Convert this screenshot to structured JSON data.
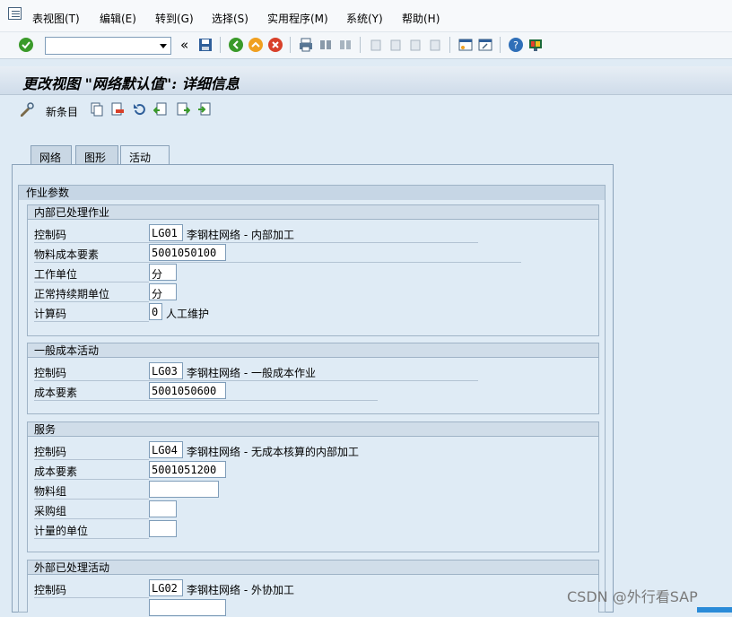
{
  "menu": [
    "表视图(T)",
    "编辑(E)",
    "转到(G)",
    "选择(S)",
    "实用程序(M)",
    "系统(Y)",
    "帮助(H)"
  ],
  "toolbar": {
    "command_value": "",
    "collapse_symbol": "«"
  },
  "title": "更改视图 \"网络默认值\": 详细信息",
  "app_toolbar": {
    "new_entries": "新条目"
  },
  "tabs": [
    "网络",
    "图形",
    "活动"
  ],
  "active_tab": "活动",
  "section_title": "作业参数",
  "groups": {
    "internal": {
      "title": "内部已处理作业",
      "control_key_label": "控制码",
      "control_key": "LG01",
      "control_key_desc": "李钢柱网络 - 内部加工",
      "cost_element_label": "物料成本要素",
      "cost_element": "5001050100",
      "work_unit_label": "工作单位",
      "work_unit": "分",
      "duration_unit_label": "正常持续期单位",
      "duration_unit": "分",
      "calc_key_label": "计算码",
      "calc_key": "0",
      "calc_key_desc": "人工维护"
    },
    "general": {
      "title": "一般成本活动",
      "control_key_label": "控制码",
      "control_key": "LG03",
      "control_key_desc": "李钢柱网络 - 一般成本作业",
      "cost_element_label": "成本要素",
      "cost_element": "5001050600"
    },
    "service": {
      "title": "服务",
      "control_key_label": "控制码",
      "control_key": "LG04",
      "control_key_desc": "李钢柱网络 - 无成本核算的内部加工",
      "cost_element_label": "成本要素",
      "cost_element": "5001051200",
      "material_group_label": "物料组",
      "material_group": "",
      "purchasing_group_label": "采购组",
      "purchasing_group": "",
      "order_unit_label": "计量的单位",
      "order_unit": ""
    },
    "external": {
      "title": "外部已处理活动",
      "control_key_label": "控制码",
      "control_key": "LG02",
      "control_key_desc": "李钢柱网络 - 外协加工"
    }
  },
  "watermark": "CSDN @外行看SAP",
  "colors": {
    "background": "#dfebf5",
    "accent": "#2a8bd8",
    "check_green": "#3a9a2a"
  }
}
